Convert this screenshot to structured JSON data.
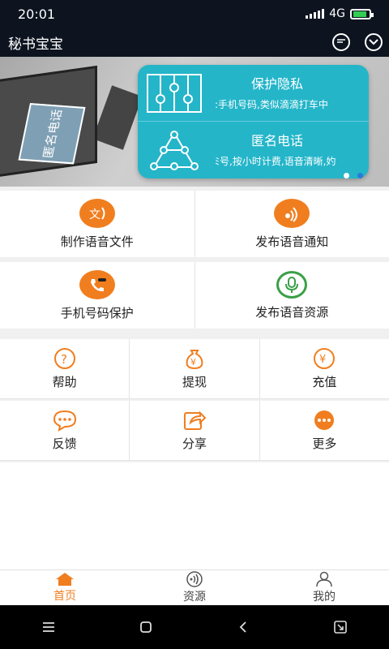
{
  "status": {
    "time": "20:01",
    "network": "4G"
  },
  "app": {
    "title": "秘书宝宝"
  },
  "banner": {
    "book_text": "匿名电话",
    "card": [
      {
        "title": "保护隐私",
        "desc": ":手机号码,类似滴滴打车中"
      },
      {
        "title": "匿名电话",
        "desc": "ﾐ号,按小时计费,语音清晰,妁"
      }
    ]
  },
  "features_top": [
    {
      "label": "制作语音文件",
      "icon": "voice-text-icon",
      "glyph": "文"
    },
    {
      "label": "发布语音通知",
      "icon": "broadcast-icon",
      "glyph": "))"
    }
  ],
  "features_mid": [
    {
      "label": "手机号码保护",
      "icon": "phone-mask-icon",
      "glyph": "☎"
    },
    {
      "label": "发布语音资源",
      "icon": "microphone-icon",
      "glyph": "🎙"
    }
  ],
  "grid": [
    {
      "label": "帮助",
      "icon": "help-icon",
      "glyph": "?"
    },
    {
      "label": "提现",
      "icon": "money-bag-icon",
      "glyph": "¥"
    },
    {
      "label": "充值",
      "icon": "recharge-icon",
      "glyph": "¥"
    },
    {
      "label": "反馈",
      "icon": "feedback-icon",
      "glyph": "…"
    },
    {
      "label": "分享",
      "icon": "share-icon",
      "glyph": "↗"
    },
    {
      "label": "更多",
      "icon": "more-icon",
      "glyph": "•••"
    }
  ],
  "tabs": [
    {
      "label": "首页",
      "icon": "home-icon",
      "active": true
    },
    {
      "label": "资源",
      "icon": "resource-icon",
      "active": false
    },
    {
      "label": "我的",
      "icon": "profile-icon",
      "active": false
    }
  ],
  "colors": {
    "accent": "#f07e1f",
    "green": "#3aa046",
    "dark": "#0d1420",
    "card": "#24b5c9"
  }
}
